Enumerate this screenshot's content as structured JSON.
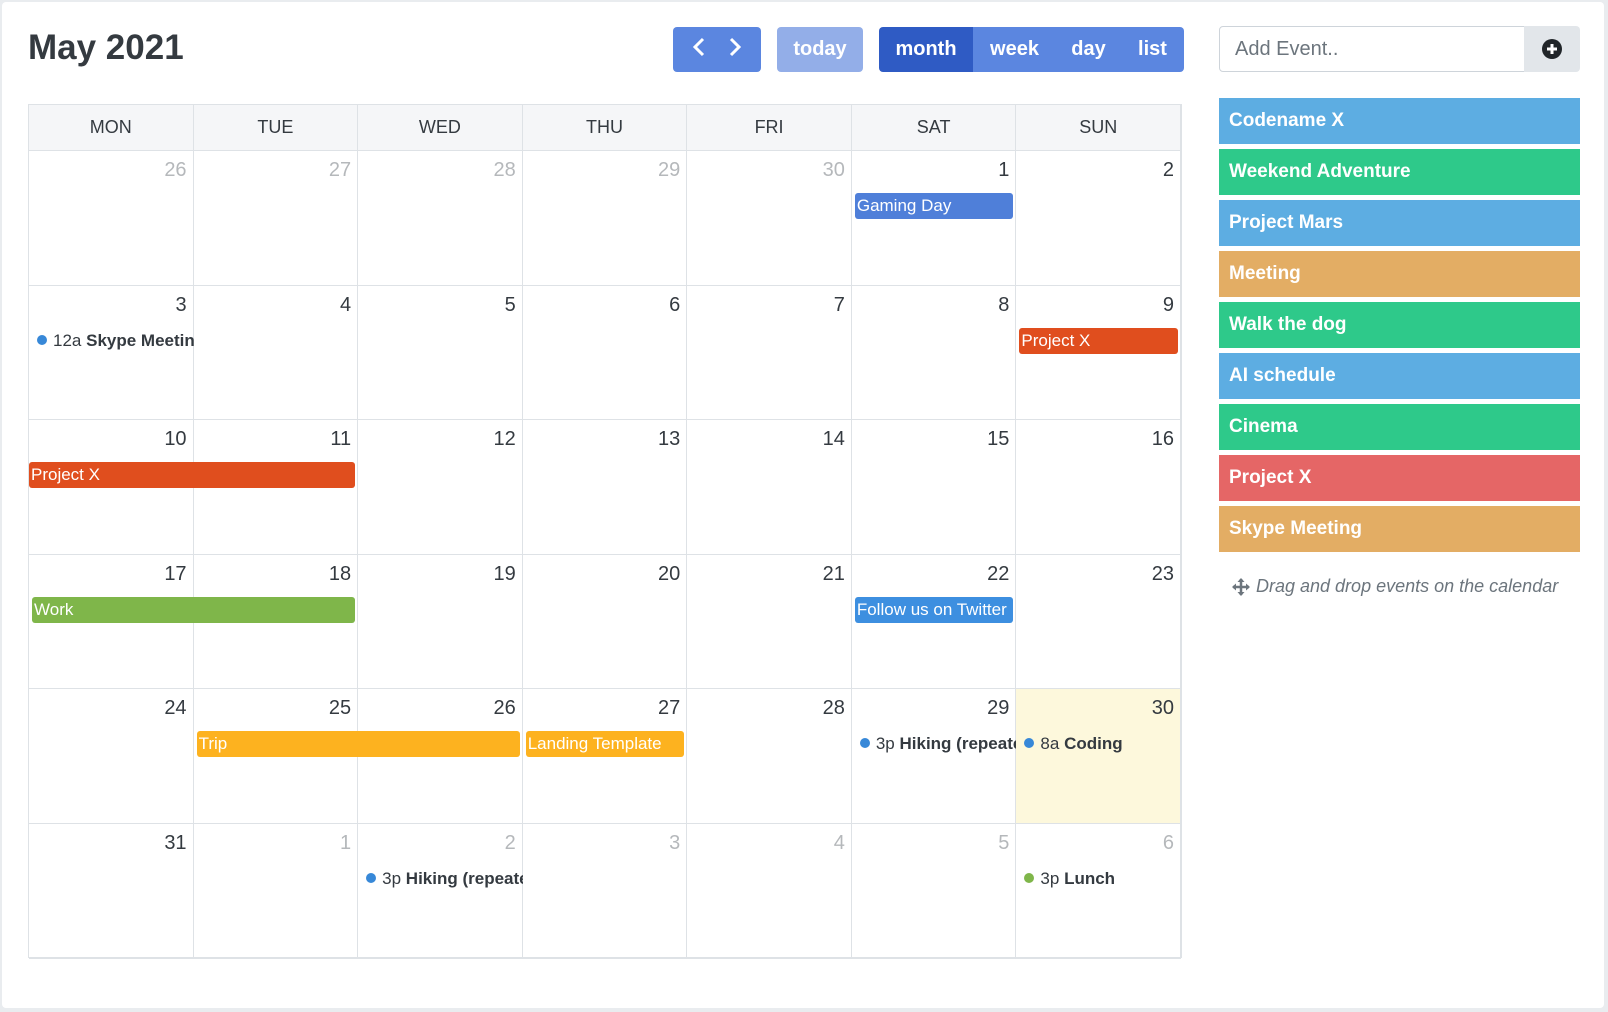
{
  "header": {
    "title": "May 2021",
    "today_label": "today",
    "views": [
      "month",
      "week",
      "day",
      "list"
    ],
    "active_view": "month"
  },
  "weekdays": [
    "MON",
    "TUE",
    "WED",
    "THU",
    "FRI",
    "SAT",
    "SUN"
  ],
  "weeks": [
    [
      {
        "d": "26",
        "o": true
      },
      {
        "d": "27",
        "o": true
      },
      {
        "d": "28",
        "o": true
      },
      {
        "d": "29",
        "o": true
      },
      {
        "d": "30",
        "o": true
      },
      {
        "d": "1"
      },
      {
        "d": "2"
      }
    ],
    [
      {
        "d": "3"
      },
      {
        "d": "4"
      },
      {
        "d": "5"
      },
      {
        "d": "6"
      },
      {
        "d": "7"
      },
      {
        "d": "8"
      },
      {
        "d": "9"
      }
    ],
    [
      {
        "d": "10"
      },
      {
        "d": "11"
      },
      {
        "d": "12"
      },
      {
        "d": "13"
      },
      {
        "d": "14"
      },
      {
        "d": "15"
      },
      {
        "d": "16"
      }
    ],
    [
      {
        "d": "17"
      },
      {
        "d": "18"
      },
      {
        "d": "19"
      },
      {
        "d": "20"
      },
      {
        "d": "21"
      },
      {
        "d": "22"
      },
      {
        "d": "23"
      }
    ],
    [
      {
        "d": "24"
      },
      {
        "d": "25"
      },
      {
        "d": "26"
      },
      {
        "d": "27"
      },
      {
        "d": "28"
      },
      {
        "d": "29"
      },
      {
        "d": "30",
        "today": true
      }
    ],
    [
      {
        "d": "31"
      },
      {
        "d": "1",
        "o": true
      },
      {
        "d": "2",
        "o": true
      },
      {
        "d": "3",
        "o": true
      },
      {
        "d": "4",
        "o": true
      },
      {
        "d": "5",
        "o": true
      },
      {
        "d": "6",
        "o": true
      }
    ]
  ],
  "bar_events": [
    {
      "title": "Gaming Day",
      "week": 0,
      "day": 5,
      "span": 1,
      "color": "#4f7fd9"
    },
    {
      "title": "Project X",
      "week": 1,
      "day": 6,
      "span": 1,
      "color": "#e04e1e"
    },
    {
      "title": "Project X",
      "week": 2,
      "day": 0,
      "span": 2,
      "color": "#e04e1e"
    },
    {
      "title": "Work",
      "week": 3,
      "day": 0,
      "span": 2,
      "color": "#7fb64a"
    },
    {
      "title": "Follow us on Twitter",
      "week": 3,
      "day": 5,
      "span": 1,
      "color": "#3d8fe0"
    },
    {
      "title": "Trip",
      "week": 4,
      "day": 1,
      "span": 2,
      "color": "#fdb21f"
    },
    {
      "title": "Landing Template",
      "week": 4,
      "day": 3,
      "span": 1,
      "color": "#fdb21f"
    }
  ],
  "dot_events": [
    {
      "time": "12a",
      "title": "Skype Meeting",
      "week": 1,
      "day": 0,
      "color": "#3788d8"
    },
    {
      "time": "3p",
      "title": "Hiking (repeated)",
      "week": 4,
      "day": 5,
      "color": "#3788d8"
    },
    {
      "time": "8a",
      "title": "Coding",
      "week": 4,
      "day": 6,
      "color": "#3788d8"
    },
    {
      "time": "3p",
      "title": "Hiking (repeated)",
      "week": 5,
      "day": 2,
      "color": "#3788d8"
    },
    {
      "time": "3p",
      "title": "Lunch",
      "week": 5,
      "day": 6,
      "color": "#7fb64a"
    }
  ],
  "sidebar": {
    "placeholder": "Add Event..",
    "events": [
      {
        "title": "Codename X",
        "color": "#5dade2"
      },
      {
        "title": "Weekend Adventure",
        "color": "#2ec98a"
      },
      {
        "title": "Project Mars",
        "color": "#5dade2"
      },
      {
        "title": "Meeting",
        "color": "#e3ad64"
      },
      {
        "title": "Walk the dog",
        "color": "#2ec98a"
      },
      {
        "title": "AI schedule",
        "color": "#5dade2"
      },
      {
        "title": "Cinema",
        "color": "#2ec98a"
      },
      {
        "title": "Project X",
        "color": "#e56666"
      },
      {
        "title": "Skype Meeting",
        "color": "#e3ad64"
      }
    ],
    "hint": "Drag and drop events on the calendar"
  }
}
